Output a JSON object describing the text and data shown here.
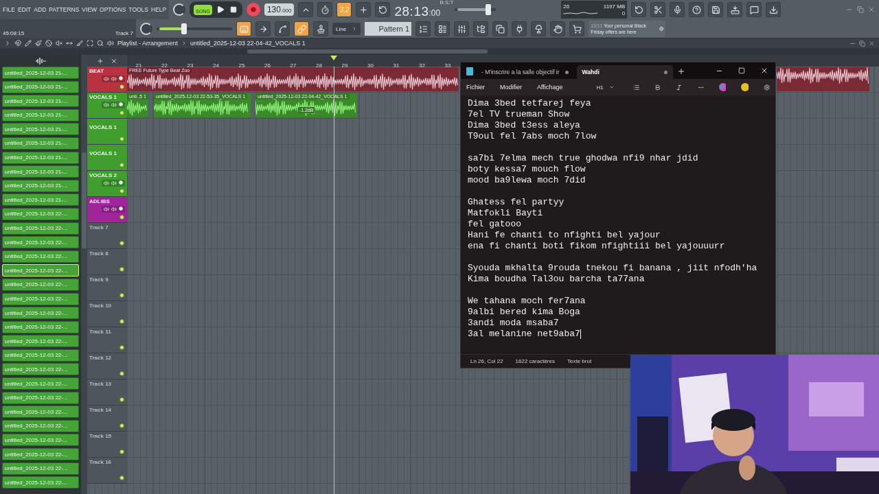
{
  "menu": [
    "FILE",
    "EDIT",
    "ADD",
    "PATTERNS",
    "VIEW",
    "OPTIONS",
    "TOOLS",
    "HELP"
  ],
  "hint": {
    "time": "45:08:15",
    "track": "Track 7"
  },
  "mode_switch": {
    "label": "SONG",
    "on": true
  },
  "tempo": {
    "whole": "130",
    "fraction": ".000"
  },
  "toolbar_row1": [
    {
      "kind": "tilt",
      "on": false
    },
    {
      "kind": "timer",
      "on": false
    },
    {
      "kind": "typing",
      "label": "3.2",
      "on": true
    },
    {
      "kind": "step",
      "on": false
    },
    {
      "kind": "loop",
      "on": false
    }
  ],
  "clock": {
    "main": "28:13",
    "small": ":00",
    "format": "B:S:T"
  },
  "pitch": {
    "level": 0.85
  },
  "monitor": {
    "cpu": "26",
    "memory": "1197 MB",
    "polyphony": "0"
  },
  "toolbar_row1_right": [
    {
      "kind": "undo"
    },
    {
      "kind": "cut"
    },
    {
      "kind": "mic"
    },
    {
      "kind": "help"
    },
    {
      "kind": "save"
    },
    {
      "kind": "export"
    },
    {
      "kind": "chat"
    },
    {
      "kind": "download"
    }
  ],
  "master_volume": {
    "level": 0.35
  },
  "toolbar_row2": [
    {
      "kind": "keyboard",
      "on": true
    },
    {
      "kind": "arrow",
      "on": false
    },
    {
      "kind": "curve",
      "on": false
    },
    {
      "kind": "link",
      "on": true
    },
    {
      "kind": "stamp",
      "on": false
    }
  ],
  "snap": "Line",
  "pattern": "Pattern 1",
  "toolbar_row2_right": [
    {
      "kind": "steps"
    },
    {
      "kind": "list"
    },
    {
      "kind": "mixer"
    },
    {
      "kind": "tree"
    },
    {
      "kind": "copy"
    },
    {
      "kind": "plug"
    },
    {
      "kind": "lamp"
    },
    {
      "kind": "hand"
    },
    {
      "kind": "cart"
    }
  ],
  "news": {
    "date": "13/11",
    "text": "Your personal Black Friday offers are here"
  },
  "playlist": {
    "title": "Playlist - Arrangement",
    "breadcrumb": "untitled_2025-12-03 22-04-42_VOCALS 1"
  },
  "playlist_tools": [
    {
      "kind": "play"
    },
    {
      "kind": "magnet"
    },
    {
      "kind": "pencil"
    },
    {
      "kind": "brush"
    },
    {
      "kind": "ban"
    },
    {
      "kind": "mute"
    },
    {
      "kind": "slip"
    },
    {
      "kind": "slice"
    },
    {
      "kind": "select"
    },
    {
      "kind": "zoom"
    },
    {
      "kind": "speaker"
    }
  ],
  "browser": [
    {
      "label": "untitled_2025-12-03 21-...",
      "selected": false
    },
    {
      "label": "untitled_2025-12-03 21-...",
      "selected": false
    },
    {
      "label": "untitled_2025-12-03 21-...",
      "selected": false
    },
    {
      "label": "untitled_2025-12-03 21-...",
      "selected": false
    },
    {
      "label": "untitled_2025-12-03 21-...",
      "selected": false
    },
    {
      "label": "untitled_2025-12-03 21-...",
      "selected": false
    },
    {
      "label": "untitled_2025-12-03 21-...",
      "selected": false
    },
    {
      "label": "untitled_2025-12-03 21-...",
      "selected": false
    },
    {
      "label": "untitled_2025-12-03 21-...",
      "selected": false
    },
    {
      "label": "untitled_2025-12-03 21-...",
      "selected": false
    },
    {
      "label": "untitled_2025-12-03 22-...",
      "selected": false
    },
    {
      "label": "untitled_2025-12-03 22-...",
      "selected": false
    },
    {
      "label": "untitled_2025-12-03 22-...",
      "selected": false
    },
    {
      "label": "untitled_2025-12-03 22-...",
      "selected": false
    },
    {
      "label": "untitled_2025-12-03 22-...",
      "selected": true
    },
    {
      "label": "untitled_2025-12-03 22-...",
      "selected": false
    },
    {
      "label": "untitled_2025-12-03 22-...",
      "selected": false
    },
    {
      "label": "untitled_2025-12-03 22-...",
      "selected": false
    },
    {
      "label": "untitled_2025-12-03 22-...",
      "selected": false
    },
    {
      "label": "untitled_2025-12-03 22-...",
      "selected": false
    },
    {
      "label": "untitled_2025-12-03 22-...",
      "selected": false
    },
    {
      "label": "untitled_2025-12-03 22-...",
      "selected": false
    },
    {
      "label": "untitled_2025-12-03 22-...",
      "selected": false
    },
    {
      "label": "untitled_2025-12-03 22-...",
      "selected": false
    },
    {
      "label": "untitled_2025-12-03 22-...",
      "selected": false
    },
    {
      "label": "untitled_2025-12-03 22-...",
      "selected": false
    },
    {
      "label": "untitled_2025-12-03 22-...",
      "selected": false
    },
    {
      "label": "untitled_2025-12-03 22-...",
      "selected": false
    },
    {
      "label": "untitled_2025-12-03 22-...",
      "selected": false
    },
    {
      "label": "untitled_2025-12-03 22-...",
      "selected": false
    }
  ],
  "ruler": [
    "21",
    "22",
    "23",
    "24",
    "25",
    "26",
    "27",
    "28",
    "29",
    "30",
    "31",
    "32",
    "33"
  ],
  "tracks": [
    {
      "name": "BEAT",
      "kind": "track",
      "color": "#b8323f",
      "clips": [
        {
          "label": "FREE Future Type Beat Zoo"
        }
      ]
    },
    {
      "name": "VOCALS 1",
      "kind": "track",
      "color": "#3f9e2e",
      "clips": [
        {
          "label": "unti..5 1"
        },
        {
          "label": "untitled_2025-12-03 22-53-35_VOCALS 1"
        },
        {
          "label": "untitled_2025-12-03 22-04-42_VOCALS 1",
          "gain": "-1.2dB"
        }
      ]
    },
    {
      "name": "VOCALS 1",
      "kind": "lane",
      "color": "#3f9e2e"
    },
    {
      "name": "VOCALS 1",
      "kind": "lane",
      "color": "#3f9e2e"
    },
    {
      "name": "VOCALS 2",
      "kind": "track",
      "color": "#3f9e2e"
    },
    {
      "name": "ADLIBS",
      "kind": "track",
      "color": "#a0259a"
    },
    {
      "name": "Track 7",
      "kind": "empty"
    },
    {
      "name": "Track 8",
      "kind": "empty"
    },
    {
      "name": "Track 9",
      "kind": "empty"
    },
    {
      "name": "Track 10",
      "kind": "empty"
    },
    {
      "name": "Track 11",
      "kind": "empty"
    },
    {
      "name": "Track 12",
      "kind": "empty"
    },
    {
      "name": "Track 13",
      "kind": "empty"
    },
    {
      "name": "Track 14",
      "kind": "empty"
    },
    {
      "name": "Track 15",
      "kind": "empty"
    },
    {
      "name": "Track 16",
      "kind": "empty"
    }
  ],
  "notepad": {
    "tabs": [
      {
        "label": "- M'inscrire a la salle objectif ir",
        "selected": false,
        "unsaved": true
      },
      {
        "label": "Wahdi",
        "selected": true,
        "unsaved": true
      }
    ],
    "menu": [
      "Fichier",
      "Modifier",
      "Affichage"
    ],
    "heading": "H1",
    "stanzas": [
      [
        "Dima 3bed tetfarej feya",
        "7el TV trueman Show",
        "Dima 3bed t3ess aleya",
        "T9oul fel 7abs moch 7low"
      ],
      [
        "sa7bi 7elma mech true ghodwa nfi9 nhar jdid",
        "boty kessa7 mouch flow",
        "mood ba9lewa moch 7did"
      ],
      [
        "Ghatess fel partyy",
        "Matfokli Bayti",
        "fel gatooo",
        "Hani fe chanti to nfighti bel yajour",
        "ena fi chanti boti fikom nfightiii bel yajouuurr"
      ],
      [
        "Syouda mkhalta 9rouda tnekou fi banana , jiit nfodh'ha",
        "Kima boudha Tal3ou barcha ta77ana"
      ],
      [
        "We tahana moch fer7ana",
        "9albi bered kima Boga",
        "3andi moda msaba7",
        "3al melanine net9aba7"
      ]
    ],
    "status": [
      "Ln 26, Col 22",
      "1622 caractères",
      "Texte brut"
    ]
  },
  "webcam": {
    "kind": "picture"
  }
}
